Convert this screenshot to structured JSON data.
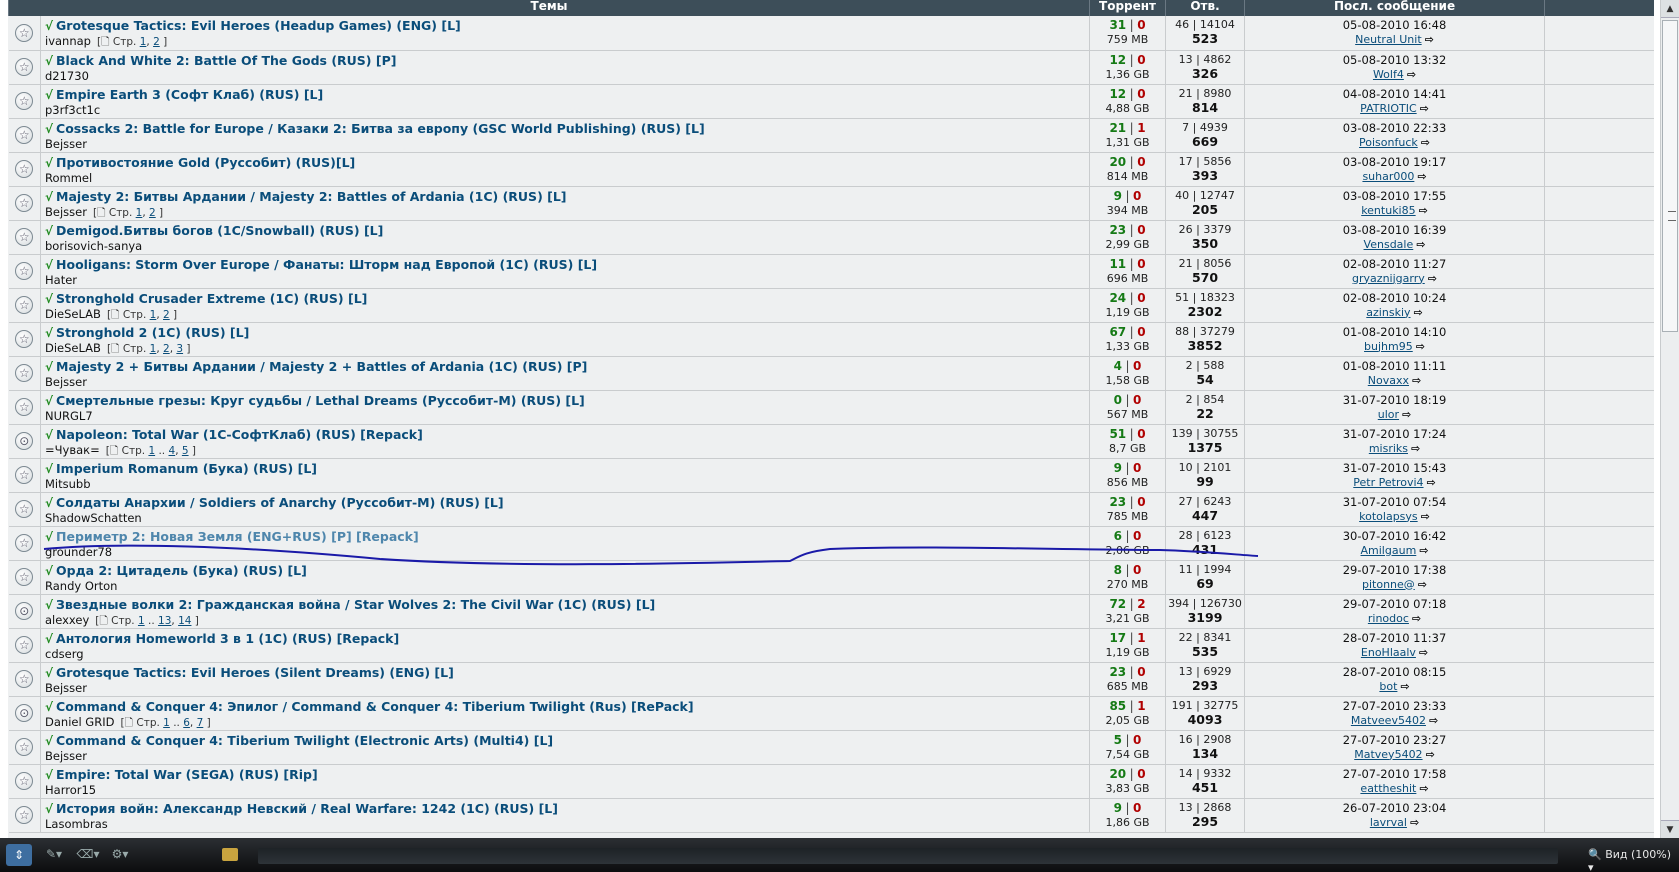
{
  "headers": {
    "topics": "Темы",
    "torrent": "Торрент",
    "replies": "Отв.",
    "last_post": "Посл. сообщение"
  },
  "pages_prefix": "Стр.",
  "rows": [
    {
      "title": "Grotesque Tactics: Evil Heroes (Headup Games) (ENG) [L]",
      "author": "ivannap",
      "pages": [
        "1",
        "2"
      ],
      "seed": "31",
      "leech": "0",
      "size": "759 MB",
      "replies": "46 | 14104",
      "views": "523",
      "date": "05-08-2010 16:48",
      "user": "Neutral Unit"
    },
    {
      "title": "Black And White 2: Battle Of The Gods (RUS) [P]",
      "author": "d21730",
      "pages": [],
      "seed": "12",
      "leech": "0",
      "size": "1,36 GB",
      "replies": "13 | 4862",
      "views": "326",
      "date": "05-08-2010 13:32",
      "user": "Wolf4"
    },
    {
      "title": "Empire Earth 3 (Софт Клаб) (RUS) [L]",
      "author": "p3rf3ct1c",
      "pages": [],
      "seed": "12",
      "leech": "0",
      "size": "4,88 GB",
      "replies": "21 | 8980",
      "views": "814",
      "date": "04-08-2010 14:41",
      "user": "PATRIOTIC"
    },
    {
      "title": "Cossacks 2: Battle for Europe / Казаки 2: Битва за европу (GSC World Publishing) (RUS) [L]",
      "author": "Bejsser",
      "pages": [],
      "seed": "21",
      "leech": "1",
      "size": "1,31 GB",
      "replies": "7 | 4939",
      "views": "669",
      "date": "03-08-2010 22:33",
      "user": "Poisonfuck"
    },
    {
      "title": "Противостояние Gold (Руссобит) (RUS)[L]",
      "author": "Rommel",
      "pages": [],
      "seed": "20",
      "leech": "0",
      "size": "814 MB",
      "replies": "17 | 5856",
      "views": "393",
      "date": "03-08-2010 19:17",
      "user": "suhar000"
    },
    {
      "title": "Majesty 2: Битвы Ардании / Majesty 2: Battles of Ardania (1C) (RUS) [L]",
      "author": "Bejsser",
      "pages": [
        "1",
        "2"
      ],
      "seed": "9",
      "leech": "0",
      "size": "394 MB",
      "replies": "40 | 12747",
      "views": "205",
      "date": "03-08-2010 17:55",
      "user": "kentuki85"
    },
    {
      "title": "Demigod.Битвы богов (1C/Snowball) (RUS) [L]",
      "author": "borisovich-sanya",
      "pages": [],
      "seed": "23",
      "leech": "0",
      "size": "2,99 GB",
      "replies": "26 | 3379",
      "views": "350",
      "date": "03-08-2010 16:39",
      "user": "Vensdale"
    },
    {
      "title": "Hooligans: Storm Over Europe / Фанаты: Шторм над Европой (1C) (RUS) [L]",
      "author": "Hater",
      "pages": [],
      "seed": "11",
      "leech": "0",
      "size": "696 MB",
      "replies": "21 | 8056",
      "views": "570",
      "date": "02-08-2010 11:27",
      "user": "gryaznijgarry"
    },
    {
      "title": "Stronghold Crusader Extreme (1C) (RUS) [L]",
      "author": "DieSeLAB",
      "pages": [
        "1",
        "2"
      ],
      "seed": "24",
      "leech": "0",
      "size": "1,19 GB",
      "replies": "51 | 18323",
      "views": "2302",
      "date": "02-08-2010 10:24",
      "user": "azinskiy"
    },
    {
      "title": "Stronghold 2 (1C) (RUS) [L]",
      "author": "DieSeLAB",
      "pages": [
        "1",
        "2",
        "3"
      ],
      "seed": "67",
      "leech": "0",
      "size": "1,33 GB",
      "replies": "88 | 37279",
      "views": "3852",
      "date": "01-08-2010 14:10",
      "user": "bujhm95"
    },
    {
      "title": "Majesty 2 + Битвы Ардании / Majesty 2 + Battles of Ardania (1C) (RUS) [P]",
      "author": "Bejsser",
      "pages": [],
      "seed": "4",
      "leech": "0",
      "size": "1,58 GB",
      "replies": "2 | 588",
      "views": "54",
      "date": "01-08-2010 11:11",
      "user": "Novaxx"
    },
    {
      "title": "Смертельные грезы: Круг судьбы / Lethal Dreams (Руссобит-М) (RUS) [L]",
      "author": "NURGL7",
      "pages": [],
      "seed": "0",
      "leech": "0",
      "size": "567 MB",
      "replies": "2 | 854",
      "views": "22",
      "date": "31-07-2010 18:19",
      "user": "ulor"
    },
    {
      "title": "Napoleon: Total War (1С-СофтКлаб) (RUS) [Repack]",
      "author": "=Чувак=",
      "pages": [
        "1",
        "..",
        "4",
        "5"
      ],
      "seed": "51",
      "leech": "0",
      "size": "8,7 GB",
      "replies": "139 | 30755",
      "views": "1375",
      "date": "31-07-2010 17:24",
      "user": "misriks",
      "hot": true
    },
    {
      "title": "Imperium Romanum (Бука) (RUS) [L]",
      "author": "Mitsubb",
      "pages": [],
      "seed": "9",
      "leech": "0",
      "size": "856 MB",
      "replies": "10 | 2101",
      "views": "99",
      "date": "31-07-2010 15:43",
      "user": "Petr Petrovi4"
    },
    {
      "title": "Солдаты Анархии / Soldiers of Anarchy (Руссобит-М) (RUS) [L]",
      "author": "ShadowSchatten",
      "pages": [],
      "seed": "23",
      "leech": "0",
      "size": "785 MB",
      "replies": "27 | 6243",
      "views": "447",
      "date": "31-07-2010 07:54",
      "user": "kotolapsys"
    },
    {
      "title": "Периметр 2: Новая Земля (ENG+RUS) [P] [Repack]",
      "author": "grounder78",
      "pages": [],
      "seed": "6",
      "leech": "0",
      "size": "2,06 GB",
      "replies": "28 | 6123",
      "views": "431",
      "date": "30-07-2010 16:42",
      "user": "Amilgaum",
      "visited": true
    },
    {
      "title": "Орда 2: Цитадель (Бука) (RUS) [L]",
      "author": "Randy Orton",
      "pages": [],
      "seed": "8",
      "leech": "0",
      "size": "270 MB",
      "replies": "11 | 1994",
      "views": "69",
      "date": "29-07-2010 17:38",
      "user": "pitonne@"
    },
    {
      "title": "Звездные волки 2: Гражданская война / Star Wolves 2: The Civil War (1C) (RUS) [L]",
      "author": "alexxey",
      "pages": [
        "1",
        "..",
        "13",
        "14"
      ],
      "seed": "72",
      "leech": "2",
      "size": "3,21 GB",
      "replies": "394 | 126730",
      "views": "3199",
      "date": "29-07-2010 07:18",
      "user": "rinodoc",
      "hot": true
    },
    {
      "title": "Антология Homeworld 3 в 1 (1C) (RUS) [Repack]",
      "author": "cdserg",
      "pages": [],
      "seed": "17",
      "leech": "1",
      "size": "1,19 GB",
      "replies": "22 | 8341",
      "views": "535",
      "date": "28-07-2010 11:37",
      "user": "EnoHlaalv"
    },
    {
      "title": "Grotesque Tactics: Evil Heroes (Silent Dreams) (ENG) [L]",
      "author": "Bejsser",
      "pages": [],
      "seed": "23",
      "leech": "0",
      "size": "685 MB",
      "replies": "13 | 6929",
      "views": "293",
      "date": "28-07-2010 08:15",
      "user": "bot"
    },
    {
      "title": "Command & Conquer 4: Эпилог / Command & Conquer 4: Tiberium Twilight (Rus) [RePack]",
      "author": "Daniel GRID",
      "pages": [
        "1",
        "..",
        "6",
        "7"
      ],
      "seed": "85",
      "leech": "1",
      "size": "2,05 GB",
      "replies": "191 | 32775",
      "views": "4093",
      "date": "27-07-2010 23:33",
      "user": "Matveev5402",
      "hot": true
    },
    {
      "title": "Command & Conquer 4: Tiberium Twilight (Electronic Arts) (Multi4) [L]",
      "author": "Bejsser",
      "pages": [],
      "seed": "5",
      "leech": "0",
      "size": "7,54 GB",
      "replies": "16 | 2908",
      "views": "134",
      "date": "27-07-2010 23:27",
      "user": "Matvey5402"
    },
    {
      "title": "Empire: Total War (SEGA) (RUS) [Rip]",
      "author": "Harror15",
      "pages": [],
      "seed": "20",
      "leech": "0",
      "size": "3,83 GB",
      "replies": "14 | 9332",
      "views": "451",
      "date": "27-07-2010 17:58",
      "user": "eattheshit"
    },
    {
      "title": "История войн: Александр Невский / Real Warfare: 1242 (1C) (RUS) [L]",
      "author": "Lasombras",
      "pages": [],
      "seed": "9",
      "leech": "0",
      "size": "1,86 GB",
      "replies": "13 | 2868",
      "views": "295",
      "date": "26-07-2010 23:04",
      "user": "lavrval"
    }
  ],
  "taskbar": {
    "zoom_label": "Вид (100%)",
    "start_icon": "start-icon",
    "tool_icons": [
      "pen-icon",
      "eraser-icon",
      "settings-icon"
    ]
  },
  "colors": {
    "header_bg": "#3d4e59",
    "row_bg": "#eef0f1",
    "link": "#0a4d7a",
    "visited_link": "#4e86ac",
    "seed": "#157a15",
    "leech": "#b00000",
    "ink": "#1a1aa8"
  }
}
